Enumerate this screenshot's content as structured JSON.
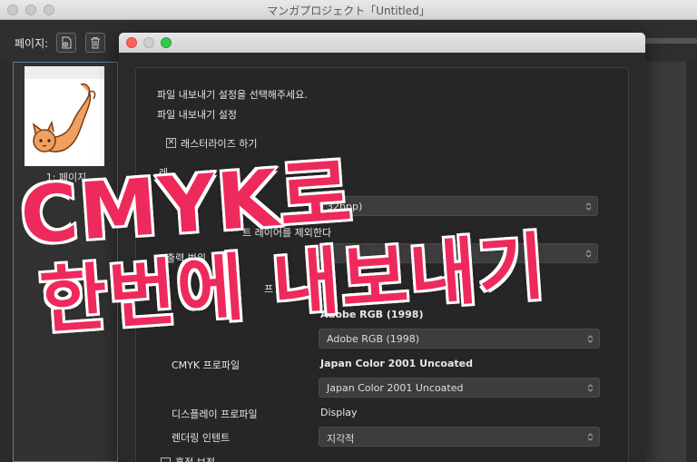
{
  "window": {
    "title": "マンガプロジェクト「Untitled」"
  },
  "toolbar": {
    "pages_label": "페이지:"
  },
  "page_panel": {
    "thumb_label": "1: 페이지"
  },
  "dialog": {
    "heading": "파일 내보내기 설정을 선택해주세요.",
    "section": "파일 내보내기 설정",
    "rasterize_label": "래스터라이즈 하기",
    "rasterize_checked": true,
    "partial_label_1": "레",
    "bitdepth_value": "32bpp)",
    "partial_label_2": "트 레이어를 제외한다",
    "output_label": "출력 범위",
    "partial_label_3": "프",
    "rgb_profile_current": "Adobe RGB (1998)",
    "rgb_profile_select": "Adobe RGB (1998)",
    "cmyk_label": "CMYK 프로파일",
    "cmyk_profile_current": "Japan Color 2001 Uncoated",
    "cmyk_profile_select": "Japan Color 2001 Uncoated",
    "display_label": "디스플레이 프로파일",
    "display_value": "Display",
    "intent_label": "렌더링 인텐트",
    "intent_value": "지각적",
    "black_point_label": "흑점 보정"
  },
  "overlay": {
    "line1": "CMYK로",
    "line2": "한번에 내보내기",
    "color": "#ee2a5d"
  },
  "icons": [
    "add-page-icon",
    "trash-icon",
    "caret-updown-icon"
  ]
}
